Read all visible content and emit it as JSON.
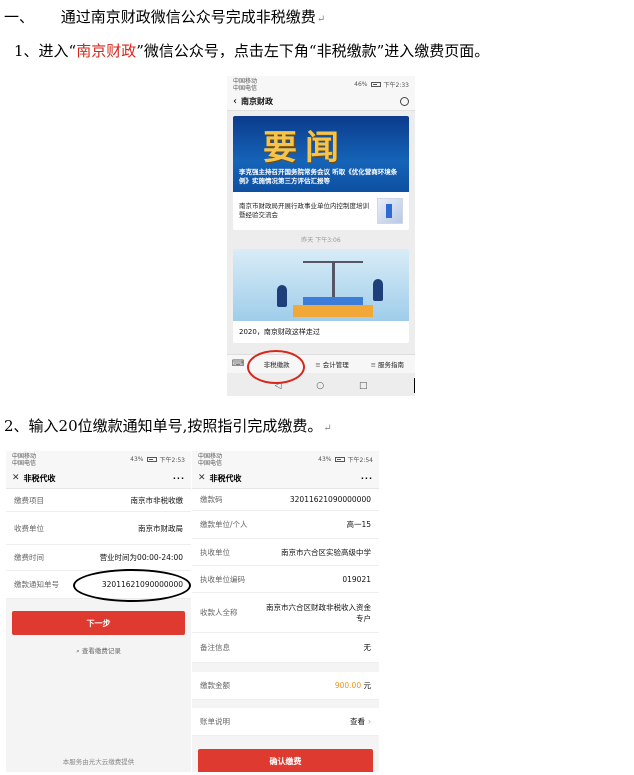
{
  "heading": {
    "num": "一、",
    "text": "通过南京财政微信公众号完成非税缴费"
  },
  "step1": {
    "pre": "1、进入“",
    "red": "南京财政",
    "post": "”微信公众号，点击左下角“非税缴款”进入缴费页面。"
  },
  "step2": {
    "text": "2、输入20位缴款通知单号,按照指引完成缴费。"
  },
  "para_mark": "↵",
  "phone1": {
    "status": {
      "carrier1": "中国移动",
      "carrier2": "中国电信",
      "right": "46%",
      "time": "下午2:33"
    },
    "title": "南京财政",
    "banner_big": "要闻",
    "banner_caption": "李克强主持召开国务院常务会议 听取《优化营商环境条例》实施情况第三方评估汇报等",
    "sub_item": "南京市财政局开展行政事业单位内控制度培训暨经验交流会",
    "timestamp": "昨天 下午3:06",
    "card2_title": "2020，南京财政这样走过",
    "menu": [
      "非税缴款",
      "会计管理",
      "服务指南"
    ],
    "nav": [
      "◁",
      "○",
      "□"
    ]
  },
  "phone2": {
    "status": {
      "carrier1": "中国移动",
      "carrier2": "中国电信",
      "right": "43%",
      "time": "下午2:53"
    },
    "title": "非税代收",
    "rows": [
      {
        "label": "缴费项目",
        "value": "南京市非税收缴"
      },
      {
        "label": "收费单位",
        "value": "南京市财政局"
      },
      {
        "label": "缴费时间",
        "value": "营业时间为00:00-24:00"
      },
      {
        "label": "缴款通知单号",
        "value": "32011621090000000"
      }
    ],
    "button": "下一步",
    "history": "查看缴费记录",
    "footer": "本服务由光大云缴费提供"
  },
  "phone3": {
    "status": {
      "carrier1": "中国移动",
      "carrier2": "中国电信",
      "right": "43%",
      "time": "下午2:54"
    },
    "title": "非税代收",
    "rows": [
      {
        "label": "缴款码",
        "value": "32011621090000000"
      },
      {
        "label": "缴款单位/个人",
        "value": "高一15"
      },
      {
        "label": "执收单位",
        "value": "南京市六合区实验高级中学"
      },
      {
        "label": "执收单位编码",
        "value": "019021"
      },
      {
        "label": "收款人全称",
        "value": "南京市六合区财政非税收入资金专户"
      },
      {
        "label": "备注信息",
        "value": "无"
      }
    ],
    "amount_label": "缴款金额",
    "amount_value": "900.00",
    "amount_unit": "元",
    "bill_label": "账单说明",
    "bill_value": "查看",
    "button": "确认缴费"
  }
}
